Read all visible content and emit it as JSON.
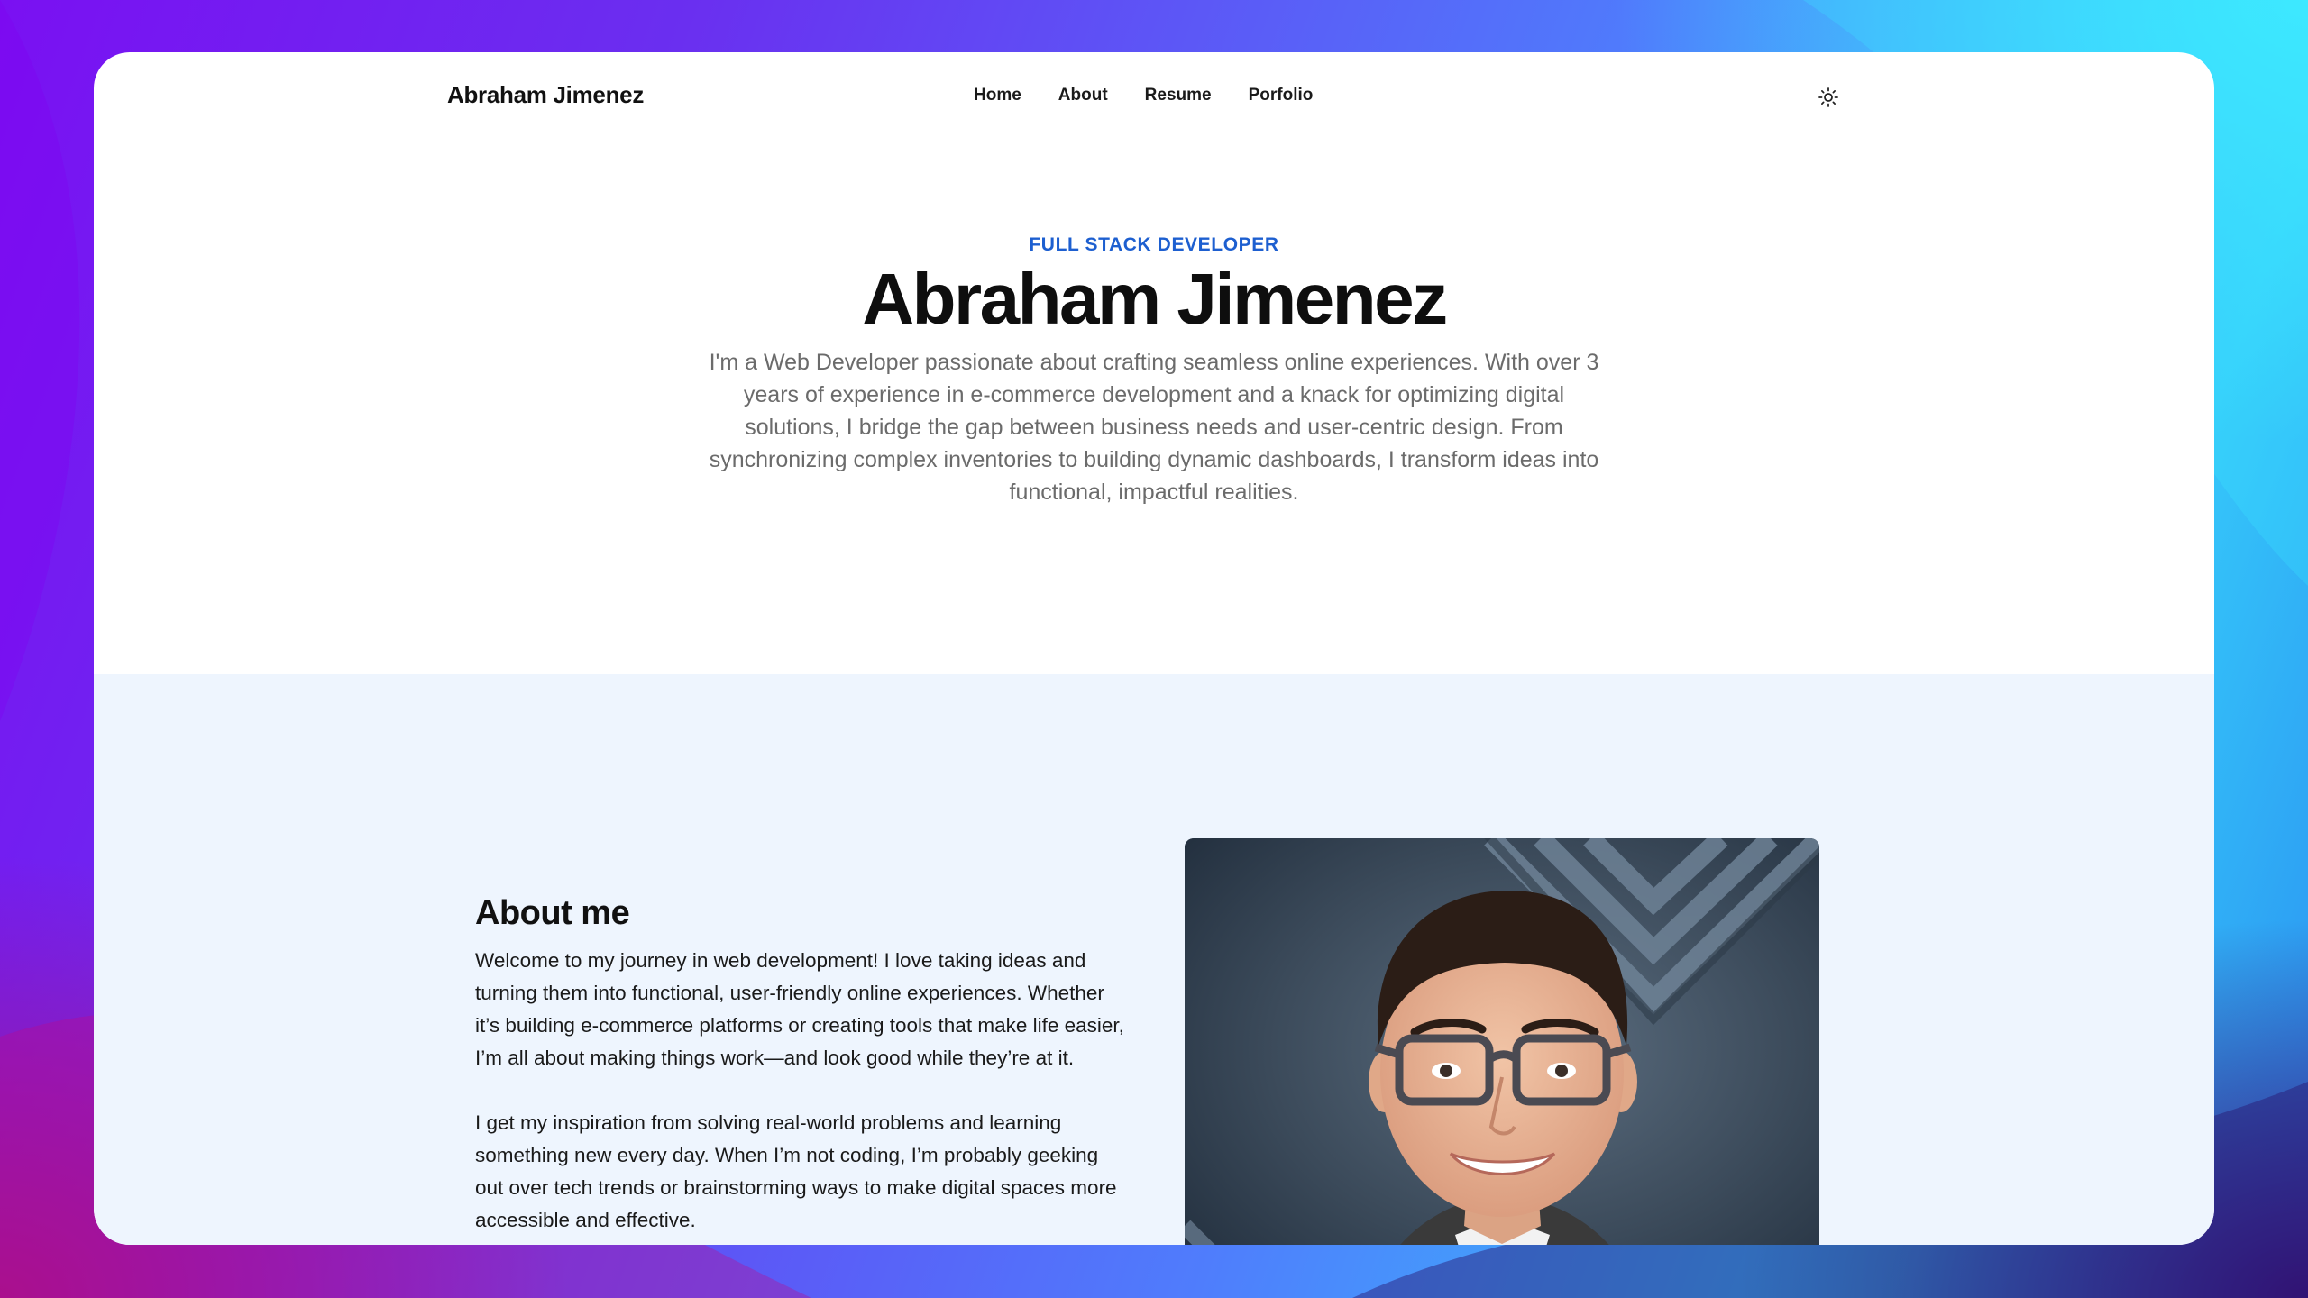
{
  "header": {
    "brand": "Abraham Jimenez",
    "nav": [
      {
        "label": "Home"
      },
      {
        "label": "About"
      },
      {
        "label": "Resume"
      },
      {
        "label": "Porfolio"
      }
    ],
    "theme_toggle_icon": "sun-icon"
  },
  "hero": {
    "eyebrow": "FULL STACK DEVELOPER",
    "title": "Abraham Jimenez",
    "description": "I'm a Web Developer passionate about crafting seamless online experiences. With over 3 years of experience in e-commerce development and a knack for optimizing digital solutions, I bridge the gap between business needs and user-centric design. From synchronizing complex inventories to building dynamic dashboards, I transform ideas into functional, impactful realities."
  },
  "about": {
    "title": "About me",
    "paragraphs": [
      "Welcome to my journey in web development! I love taking ideas and turning them into functional, user-friendly online experiences. Whether it’s building e-commerce platforms or creating tools that make life easier, I’m all about making things work—and look good while they’re at it.",
      "I get my inspiration from solving real-world problems and learning something new every day. When I’m not coding, I’m probably geeking out over tech trends or brainstorming ways to make digital spaces more accessible and effective."
    ]
  },
  "colors": {
    "accent": "#1d5fd0",
    "about_bg": "#eef5fe",
    "hero_text": "#6b6b6b"
  }
}
